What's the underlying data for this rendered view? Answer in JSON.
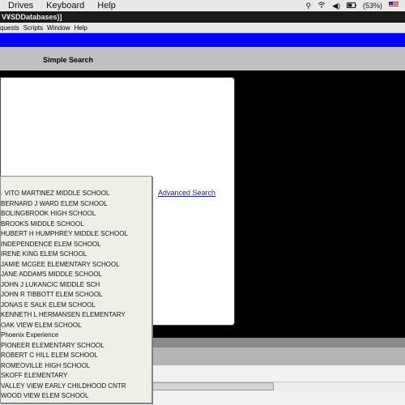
{
  "mac_menu": {
    "items": [
      "Drives",
      "Keyboard",
      "Help"
    ],
    "battery": "(53%)"
  },
  "window_title": "V¥SDDatabases)]",
  "menubar": [
    "quests",
    "Scripts",
    "Window",
    "Help"
  ],
  "header": {
    "title": "Simple Search"
  },
  "advanced_search": "Advanced Search",
  "dropdown": {
    "items": [
      ". VITO MARTINEZ MIDDLE SCHOOL",
      "BERNARD J WARD ELEM SCHOOL",
      "BOLINGBROOK HIGH SCHOOL",
      "BROOKS MIDDLE SCHOOL",
      "HUBERT H HUMPHREY MIDDLE SCHOOL",
      "INDEPENDENCE ELEM SCHOOL",
      "IRENE KING ELEM SCHOOL",
      "JAMIE MCGEE ELEMENTARY SCHOOL",
      "JANE ADDAMS MIDDLE SCHOOL",
      "JOHN J LUKANCIC MIDDLE SCH",
      "JOHN R TIBBOTT ELEM SCHOOL",
      "JONAS E SALK ELEM SCHOOL",
      "KENNETH L HERMANSEN ELEMENTARY",
      "OAK VIEW ELEM SCHOOL",
      "Phoenix Experience",
      "PIONEER ELEMENTARY SCHOOL",
      "ROBERT C HILL ELEM SCHOOL",
      "ROMEOVILLE HIGH SCHOOL",
      "SKOFF ELEMENTARY",
      "VALLEY VIEW EARLY CHILDHOOD CNTR",
      "WOOD VIEW ELEM SCHOOL"
    ]
  },
  "colors": {
    "blue_band": "#0000ff",
    "header_grey": "#c0c0c0",
    "link": "#1a1aa0"
  }
}
